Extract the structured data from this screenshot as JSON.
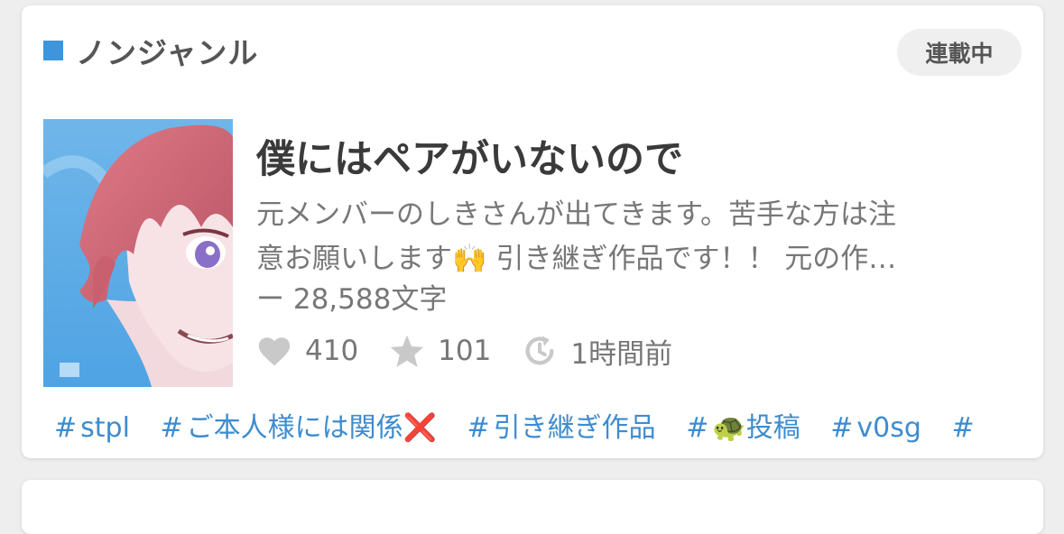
{
  "card": {
    "genre": "ノンジャンル",
    "status": "連載中",
    "title": "僕にはペアがいないので",
    "description_lines": [
      "元メンバーのしきさんが出てきます。苦手な方は注",
      "意お願いします🙌 引き継ぎ作品です！！ 元の作…"
    ],
    "char_count": "ー 28,588文字",
    "stats": {
      "likes": "410",
      "stars": "101",
      "updated": "1時間前"
    },
    "tags": [
      "stpl",
      "ご本人様には関係❌",
      "引き継ぎ作品",
      "🐢投稿",
      "v0sg",
      ""
    ]
  },
  "colors": {
    "accent": "#3d95de",
    "tag_text": "#3d8ccf",
    "heading_text": "#3a3a3a",
    "body_text": "#777777",
    "icon_gray": "#c9c9c9"
  },
  "icons": [
    "heart-icon",
    "star-icon",
    "clock-refresh-icon"
  ]
}
